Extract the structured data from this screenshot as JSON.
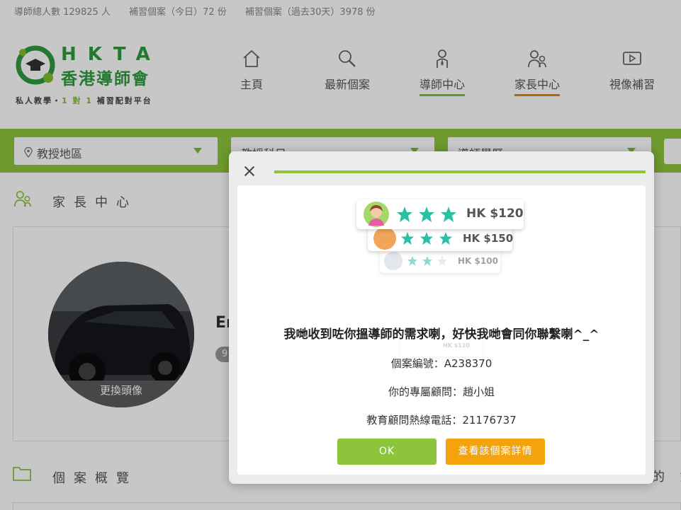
{
  "stats": {
    "tutors": "導師總人數 129825 人",
    "cases_today": "補習個案（今日）72 份",
    "cases_30": "補習個案（過去30天）3978 份"
  },
  "logo": {
    "en": "HKTA",
    "zh": "香港導師會",
    "tag_a": "私人教學・",
    "tag_b": "1 對 1",
    "tag_c": " 補習配對平台"
  },
  "nav": [
    {
      "label": "主頁",
      "icon": "home-icon"
    },
    {
      "label": "最新個案",
      "icon": "search-icon"
    },
    {
      "label": "導師中心",
      "icon": "tutor-icon"
    },
    {
      "label": "家長中心",
      "icon": "parents-icon"
    },
    {
      "label": "視像補習",
      "icon": "video-icon"
    }
  ],
  "filters": {
    "area": "教授地區",
    "subject": "教授科目",
    "education": "導師學歷"
  },
  "sections": {
    "parent_center": "家長中心",
    "case_overview": "個案概覽",
    "right_partial": "的 錯"
  },
  "profile": {
    "change_avatar": "更換頭像",
    "name_partial": "En",
    "badge_partial": "9"
  },
  "modal": {
    "headline": "我哋收到咗你搵導師的需求喇，好快我哋會同你聯繫喇^_^",
    "case_no": "個案編號：A238370",
    "consultant": "你的專屬顧問：趙小姐",
    "hotline": "教育顧問熱線電話：21176737",
    "ok": "OK",
    "view_detail": "查看該個案詳情",
    "cards": [
      {
        "price": "HK $120",
        "rating": 3
      },
      {
        "price": "HK $150",
        "rating": 3
      },
      {
        "price": "HK $100",
        "rating": 2
      },
      {
        "price": "HK $110",
        "rating": 2
      }
    ]
  },
  "colors": {
    "brand_green": "#8cc43c",
    "logo_green": "#2f9a3f",
    "accent_orange": "#f5a30c",
    "star_teal": "#2bbfa5"
  }
}
